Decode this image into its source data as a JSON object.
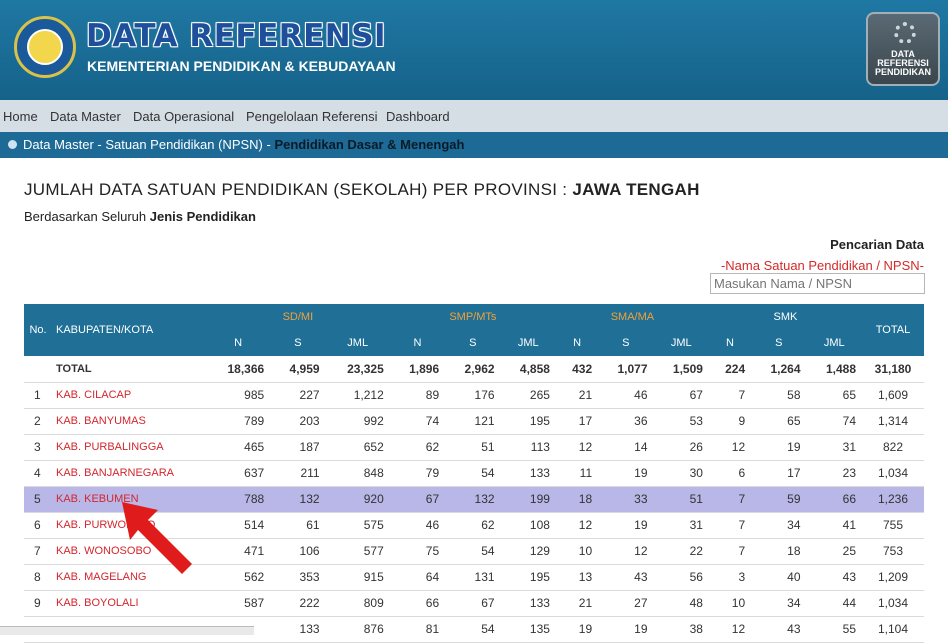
{
  "header": {
    "title": "DATA REFERENSI",
    "subtitle": "KEMENTERIAN PENDIDIKAN & KEBUDAYAAN",
    "badge_lines": [
      "DATA",
      "REFERENSI",
      "PENDIDIKAN"
    ]
  },
  "menu": [
    "Home",
    "Data Master",
    "Data Operasional",
    "Pengelolaan Referensi",
    "Dashboard"
  ],
  "breadcrumb": {
    "path": "Data Master - Satuan Pendidikan (NPSN) - ",
    "current": "Pendidikan Dasar & Menengah"
  },
  "page": {
    "title_prefix": "JUMLAH DATA SATUAN PENDIDIKAN (SEKOLAH) PER PROVINSI : ",
    "title_province": "JAWA TENGAH",
    "subtitle_prefix": "Berdasarkan Seluruh ",
    "subtitle_bold": "Jenis Pendidikan"
  },
  "search": {
    "title": "Pencarian Data",
    "hint": "-Nama Satuan Pendidikan / NPSN-",
    "placeholder": "Masukan Nama / NPSN"
  },
  "table": {
    "col_no": "No.",
    "col_name": "KABUPATEN/KOTA",
    "groups": [
      "SD/MI",
      "SMP/MTs",
      "SMA/MA",
      "SMK"
    ],
    "sub": [
      "N",
      "S",
      "JML"
    ],
    "col_total": "TOTAL",
    "rows": [
      {
        "no": "",
        "name": "TOTAL",
        "vals": [
          "18,366",
          "4,959",
          "23,325",
          "1,896",
          "2,962",
          "4,858",
          "432",
          "1,077",
          "1,509",
          "224",
          "1,264",
          "1,488",
          "31,180"
        ]
      },
      {
        "no": "1",
        "name": "KAB. CILACAP",
        "vals": [
          "985",
          "227",
          "1,212",
          "89",
          "176",
          "265",
          "21",
          "46",
          "67",
          "7",
          "58",
          "65",
          "1,609"
        ]
      },
      {
        "no": "2",
        "name": "KAB. BANYUMAS",
        "vals": [
          "789",
          "203",
          "992",
          "74",
          "121",
          "195",
          "17",
          "36",
          "53",
          "9",
          "65",
          "74",
          "1,314"
        ]
      },
      {
        "no": "3",
        "name": "KAB. PURBALINGGA",
        "vals": [
          "465",
          "187",
          "652",
          "62",
          "51",
          "113",
          "12",
          "14",
          "26",
          "12",
          "19",
          "31",
          "822"
        ]
      },
      {
        "no": "4",
        "name": "KAB. BANJARNEGARA",
        "vals": [
          "637",
          "211",
          "848",
          "79",
          "54",
          "133",
          "11",
          "19",
          "30",
          "6",
          "17",
          "23",
          "1,034"
        ]
      },
      {
        "no": "5",
        "name": "KAB. KEBUMEN",
        "vals": [
          "788",
          "132",
          "920",
          "67",
          "132",
          "199",
          "18",
          "33",
          "51",
          "7",
          "59",
          "66",
          "1,236"
        ]
      },
      {
        "no": "6",
        "name": "KAB. PURWOREJO",
        "vals": [
          "514",
          "61",
          "575",
          "46",
          "62",
          "108",
          "12",
          "19",
          "31",
          "7",
          "34",
          "41",
          "755"
        ]
      },
      {
        "no": "7",
        "name": "KAB. WONOSOBO",
        "vals": [
          "471",
          "106",
          "577",
          "75",
          "54",
          "129",
          "10",
          "12",
          "22",
          "7",
          "18",
          "25",
          "753"
        ]
      },
      {
        "no": "8",
        "name": "KAB. MAGELANG",
        "vals": [
          "562",
          "353",
          "915",
          "64",
          "131",
          "195",
          "13",
          "43",
          "56",
          "3",
          "40",
          "43",
          "1,209"
        ]
      },
      {
        "no": "9",
        "name": "KAB. BOYOLALI",
        "vals": [
          "587",
          "222",
          "809",
          "66",
          "67",
          "133",
          "21",
          "27",
          "48",
          "10",
          "34",
          "44",
          "1,034"
        ]
      },
      {
        "no": "",
        "name": "",
        "vals": [
          "",
          "133",
          "876",
          "81",
          "54",
          "135",
          "19",
          "19",
          "38",
          "12",
          "43",
          "55",
          "1,104"
        ]
      }
    ]
  },
  "colors": {
    "header": "#1f78a3",
    "menu": "#d6dee5",
    "breadcrumb": "#1d6a96",
    "table_head": "#1f6f96",
    "group_label": "#f1a23c",
    "link": "#d3262e",
    "highlight": "#b8b7e8",
    "arrow": "#e01b1b"
  }
}
